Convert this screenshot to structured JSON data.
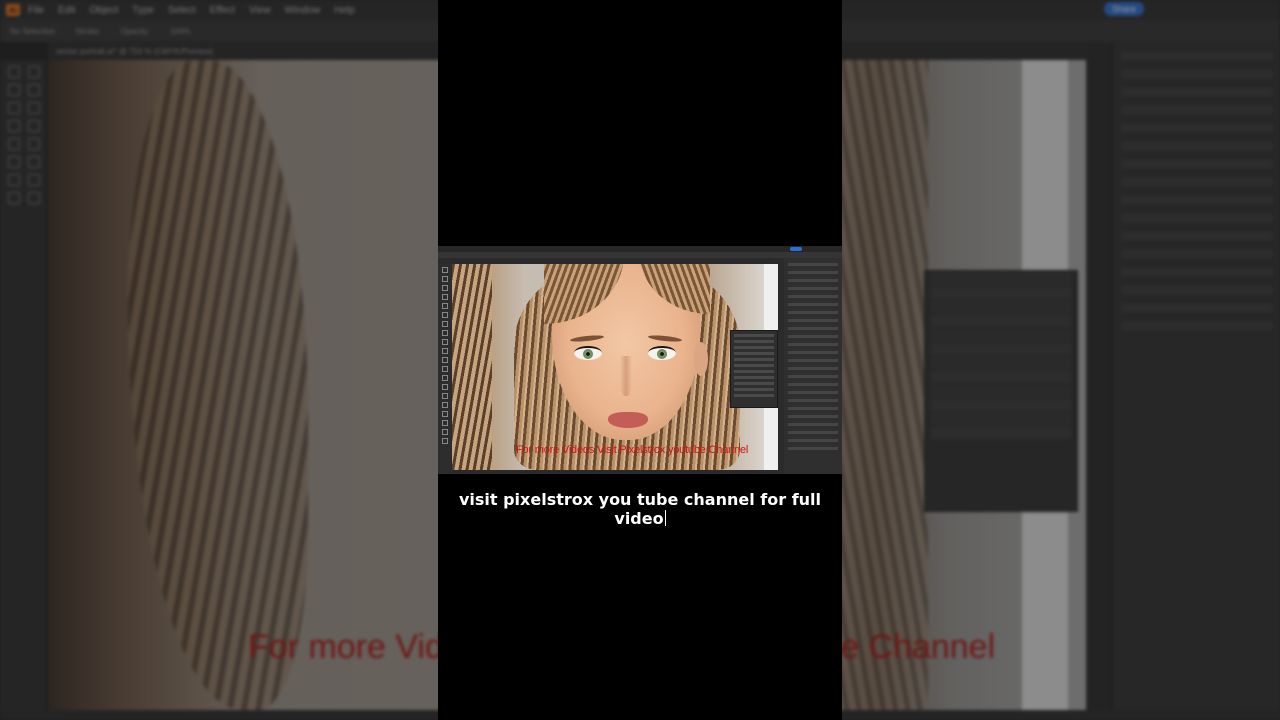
{
  "background_app": {
    "logo": "Ai",
    "menus": [
      "File",
      "Edit",
      "Object",
      "Type",
      "Select",
      "Effect",
      "View",
      "Window",
      "Help"
    ],
    "share_label": "Share",
    "document_tab": "vector portrait.ai* @ 703 % (CMYK/Preview)",
    "control_bar": [
      "No Selection",
      "Stroke:",
      "Opacity:",
      "100%"
    ],
    "watermark": "For more Videos Visit Pixelstrox youtube Channel"
  },
  "inner_screenshot": {
    "watermark": "For more Videos Visit Pixelstrox youtube Channel"
  },
  "caption": {
    "text": "visit pixelstrox you tube channel for full video"
  },
  "colors": {
    "overlay": "#000000",
    "watermark": "#d41212",
    "caption": "#ffffff",
    "share_button": "#2b6fd6"
  }
}
